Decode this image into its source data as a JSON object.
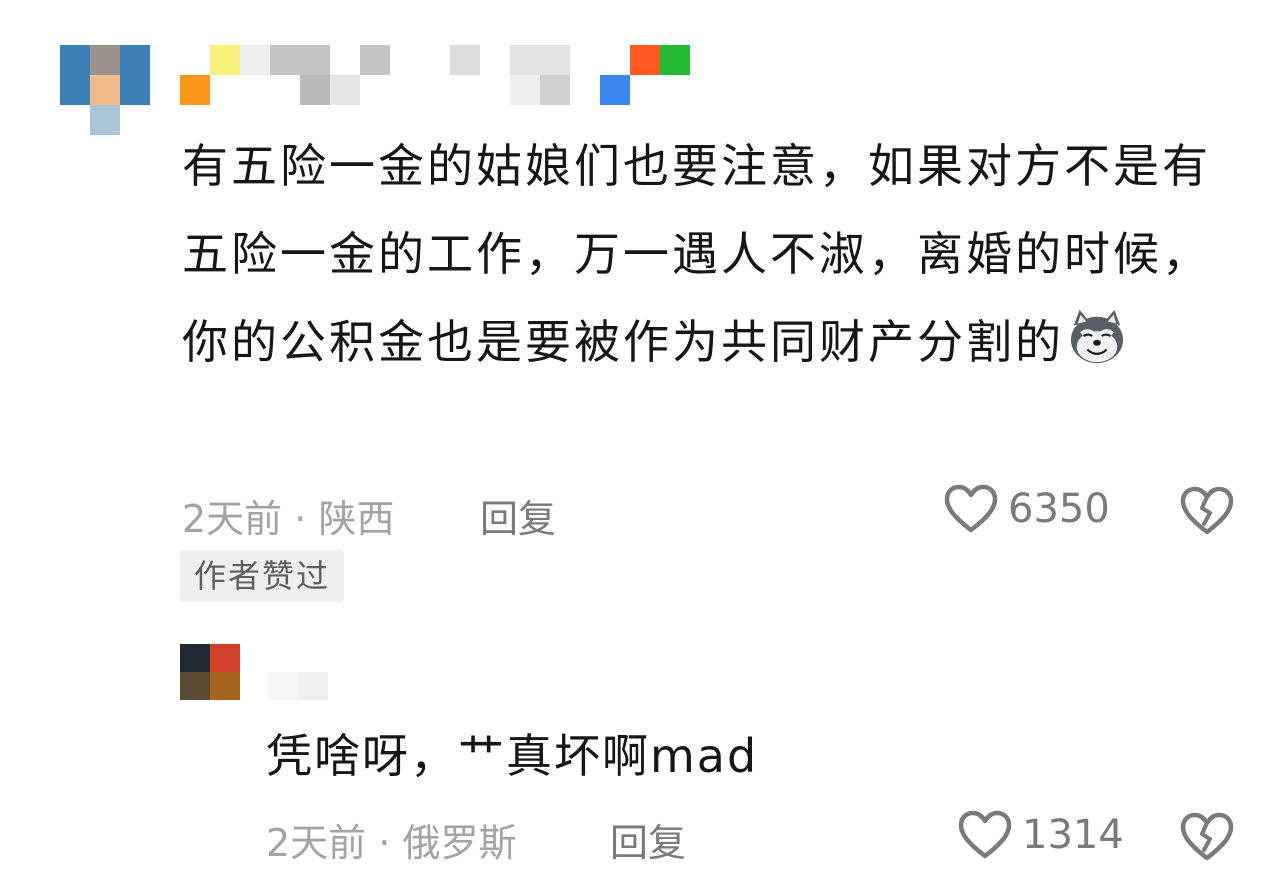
{
  "comment": {
    "text": "有五险一金的姑娘们也要注意，如果对方不是有五险一金的工作，万一遇人不淑，离婚的时候，你的公积金也是要被作为共同财产分割的",
    "emoji": "husky-emoji",
    "time": "2天前",
    "separator": "·",
    "location": "陕西",
    "reply_label": "回复",
    "like_count": "6350",
    "author_liked_badge": "作者赞过",
    "avatar_pixels": [
      "#3a7fb5",
      "#9a9188",
      "#3a7fb5",
      "#3a7fb5",
      "#f2b98a",
      "#3a7fb5",
      "#ffffff",
      "#a9c6d8",
      "#ffffff",
      "#ffffff",
      "#ffffff",
      "#ffffff"
    ],
    "username_pixels": [
      "#ffffff",
      "#f9f27a",
      "#efefef",
      "#c4c4c4",
      "#c4c4c4",
      "#ffffff",
      "#c4c4c4",
      "#ffffff",
      "#ffffff",
      "#dcdcdc",
      "#ffffff",
      "#e3e3e3",
      "#e3e3e3",
      "#ffffff",
      "#ffffff",
      "#ff5a1f",
      "#22bb33",
      "#fa9619",
      "#ffffff",
      "#ffffff",
      "#ffffff",
      "#b9b9b9",
      "#e6e6e6",
      "#ffffff",
      "#ffffff",
      "#ffffff",
      "#ffffff",
      "#ffffff",
      "#efefef",
      "#d0d0d0",
      "#ffffff",
      "#3b86f0",
      "#ffffff",
      "#ffffff"
    ]
  },
  "reply": {
    "text": "凭啥呀，艹真坏啊mad",
    "time": "2天前",
    "separator": "·",
    "location": "俄罗斯",
    "reply_label": "回复",
    "like_count": "1314",
    "avatar_pixels": [
      "#1f2a33",
      "#d3402a",
      "#5c4a32",
      "#a7631d"
    ],
    "username_pixels": [
      "#f6f6f6",
      "#f0f0f0"
    ]
  },
  "icons": {
    "like": "heart-outline-icon",
    "dislike": "broken-heart-icon"
  }
}
